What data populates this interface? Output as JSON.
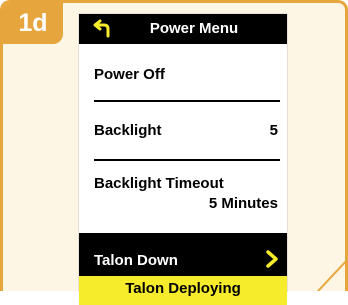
{
  "step": {
    "label": "1d"
  },
  "screen": {
    "title": "Power Menu",
    "items": [
      {
        "label": "Power Off"
      },
      {
        "label": "Backlight",
        "value": "5"
      },
      {
        "label": "Backlight Timeout",
        "value": "5 Minutes"
      }
    ],
    "highlighted": {
      "label": "Talon Down"
    },
    "status": "Talon Deploying"
  },
  "icons": {
    "back": "back-arrow-icon",
    "next": "chevron-right-icon"
  },
  "colors": {
    "accent": "#e6a63d",
    "status_banner": "#f6ec2b",
    "title_bar": "#000000",
    "frame_background": "#fdf6e4"
  }
}
